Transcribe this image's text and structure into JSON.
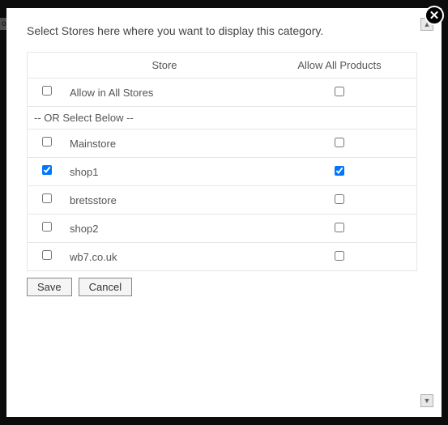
{
  "instruction": "Select Stores here where you want to display this category.",
  "headers": {
    "store": "Store",
    "allow": "Allow All Products"
  },
  "allStoresRow": {
    "label": "Allow in All Stores",
    "selected": false,
    "allow": false
  },
  "separator": "-- OR Select Below --",
  "stores": [
    {
      "name": "Mainstore",
      "selected": false,
      "allow": false
    },
    {
      "name": "shop1",
      "selected": true,
      "allow": true
    },
    {
      "name": "bretsstore",
      "selected": false,
      "allow": false
    },
    {
      "name": "shop2",
      "selected": false,
      "allow": false
    },
    {
      "name": "wb7.co.uk",
      "selected": false,
      "allow": false
    }
  ],
  "buttons": {
    "save": "Save",
    "cancel": "Cancel"
  },
  "behind": "on\nor"
}
